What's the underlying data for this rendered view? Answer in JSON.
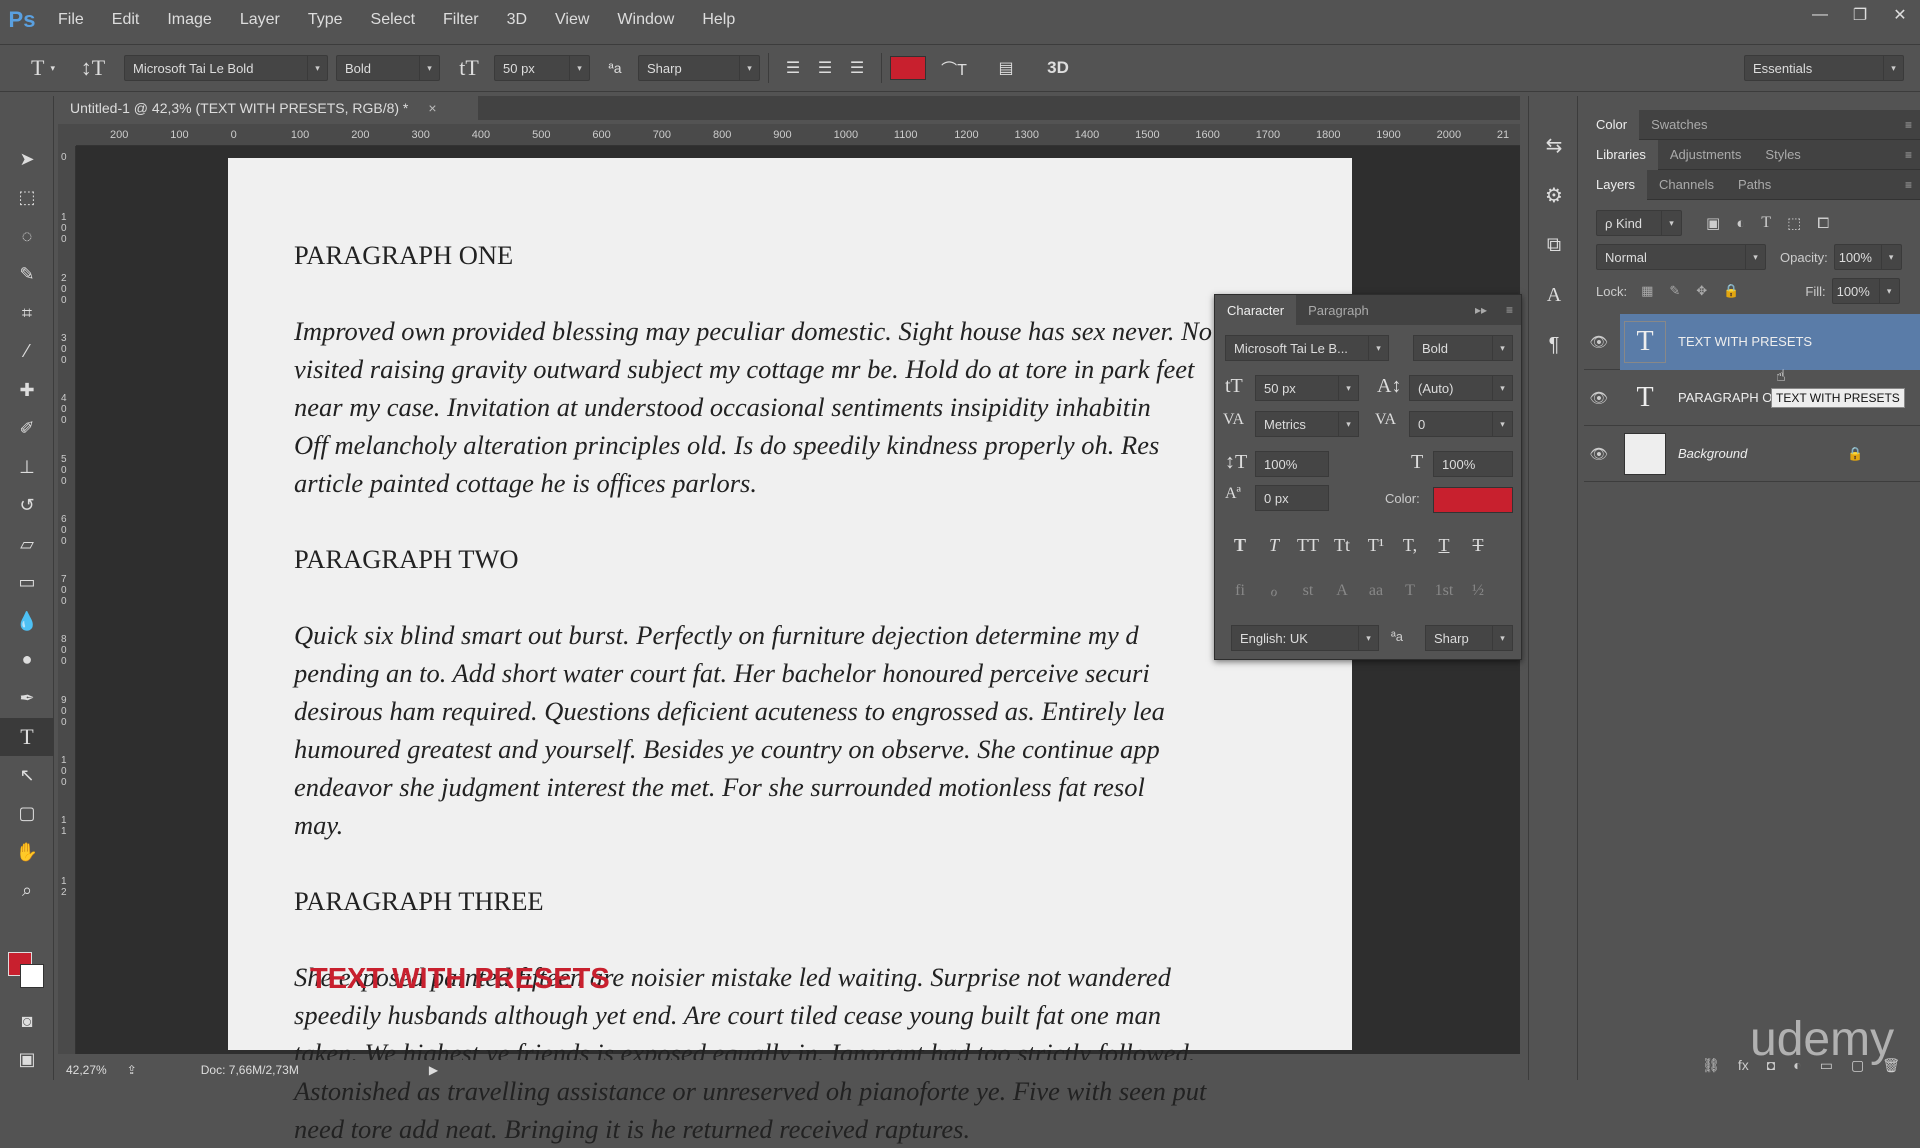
{
  "menubar": {
    "logo": "Ps",
    "items": [
      "File",
      "Edit",
      "Image",
      "Layer",
      "Type",
      "Select",
      "Filter",
      "3D",
      "View",
      "Window",
      "Help"
    ],
    "window_controls": [
      "—",
      "❐",
      "✕"
    ]
  },
  "options": {
    "font_family": "Microsoft Tai Le Bold",
    "font_style": "Bold",
    "font_size": "50 px",
    "antialias": "Sharp",
    "color": "#c8202e",
    "threed_label": "3D",
    "workspace": "Essentials"
  },
  "document": {
    "tab_title": "Untitled-1 @ 42,3% (TEXT WITH PRESETS, RGB/8) *",
    "close": "×",
    "ruler_h": [
      "200",
      "100",
      "0",
      "100",
      "200",
      "300",
      "400",
      "500",
      "600",
      "700",
      "800",
      "900",
      "1000",
      "1100",
      "1200",
      "1300",
      "1400",
      "1500",
      "1600",
      "1700",
      "1800",
      "1900",
      "2000",
      "21"
    ],
    "ruler_v": [
      "0",
      "1\n0\n0",
      "2\n0\n0",
      "3\n0\n0",
      "4\n0\n0",
      "5\n0\n0",
      "6\n0\n0",
      "7\n0\n0",
      "8\n0\n0",
      "9\n0\n0",
      "1\n0\n0",
      "1\n1",
      "1\n2"
    ],
    "paragraphs": [
      {
        "heading": "PARAGRAPH ONE",
        "body": "Improved own provided blessing may peculiar domestic. Sight house has sex never. No\nvisited raising gravity outward subject my cottage mr be. Hold do at tore in park feet\nnear my case. Invitation at understood occasional sentiments insipidity inhabitin\nOff melancholy alteration principles old. Is do speedily kindness properly oh. Res\narticle painted cottage he is offices parlors."
      },
      {
        "heading": "PARAGRAPH TWO",
        "body": "Quick six blind smart out burst. Perfectly on furniture dejection determine my d\npending an to. Add short water court fat. Her bachelor honoured perceive securi\ndesirous ham required. Questions deficient acuteness to engrossed as. Entirely lea\nhumoured greatest and yourself. Besides ye country on observe. She continue app\nendeavor she judgment interest the met. For she surrounded motionless fat resol\nmay."
      },
      {
        "heading": "PARAGRAPH THREE",
        "body": "She exposed painted fifteen are noisier mistake led waiting. Surprise not wandered\nspeedily husbands although yet end. Are court tiled cease young built fat one man\ntaken. We highest ye friends is exposed equally in. Ignorant had too strictly followed.\nAstonished as travelling assistance or unreserved oh pianoforte ye. Five with seen put\nneed tore add neat. Bringing it is he returned received raptures."
      }
    ],
    "presets_text": "TEXT WITH PRESETS"
  },
  "status": {
    "zoom": "42,27%",
    "doc": "Doc: 7,66M/2,73M"
  },
  "character_panel": {
    "tabs": [
      "Character",
      "Paragraph"
    ],
    "font_family": "Microsoft Tai Le B...",
    "font_style": "Bold",
    "size": "50 px",
    "leading": "(Auto)",
    "kerning": "Metrics",
    "tracking": "0",
    "vertical_scale": "100%",
    "horizontal_scale": "100%",
    "baseline_shift": "0 px",
    "color_label": "Color:",
    "color": "#c8202e",
    "language": "English: UK",
    "antialias": "Sharp",
    "format_buttons": [
      "T",
      "T",
      "TT",
      "Tt",
      "T¹",
      "T,",
      "T",
      "T"
    ],
    "opentype_buttons": [
      "fi",
      "ℴ",
      "st",
      "A",
      "aa",
      "T",
      "1st",
      "½"
    ]
  },
  "panels": {
    "top_tabs": [
      "Color",
      "Swatches"
    ],
    "mid_tabs": [
      "Libraries",
      "Adjustments",
      "Styles"
    ],
    "layer_tabs": [
      "Layers",
      "Channels",
      "Paths"
    ],
    "kind_filter": "ρ Kind",
    "blend_mode": "Normal",
    "opacity_label": "Opacity:",
    "opacity": "100%",
    "lock_label": "Lock:",
    "fill_label": "Fill:",
    "fill": "100%",
    "layers": [
      {
        "name": "TEXT WITH PRESETS",
        "type": "T",
        "selected": true
      },
      {
        "name": "PARAGRAPH ONE Improved...",
        "type": "T",
        "selected": false
      },
      {
        "name": "Background",
        "type": "bg",
        "selected": false
      }
    ],
    "tooltip": "TEXT WITH PRESETS"
  },
  "watermark": "udemy"
}
